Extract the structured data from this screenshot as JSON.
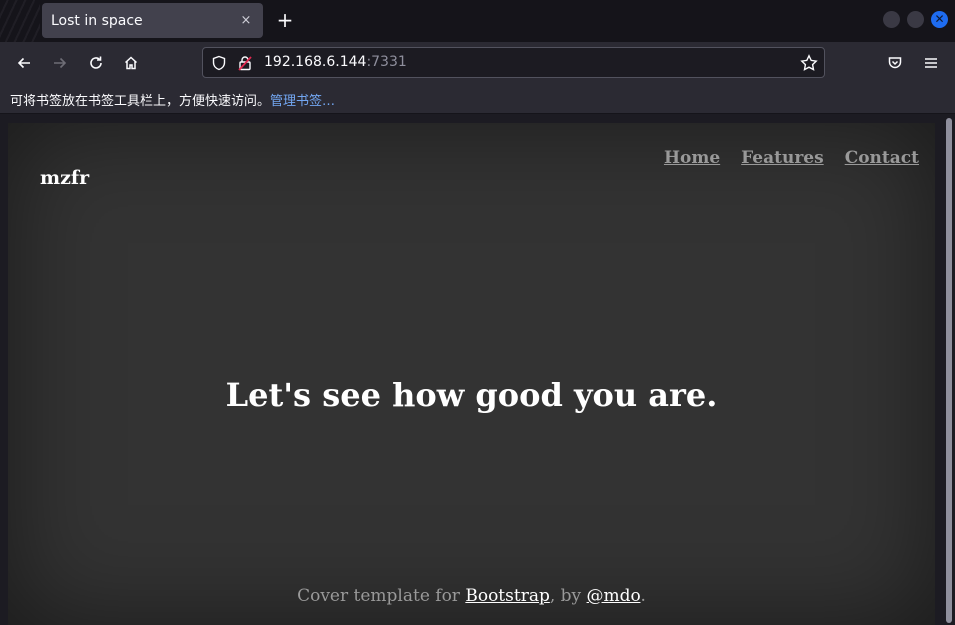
{
  "browser": {
    "tab": {
      "title": "Lost in space",
      "close_glyph": "×"
    },
    "new_tab_glyph": "+",
    "url": {
      "host": "192.168.6.144",
      "port": ":7331"
    },
    "bookmarks": {
      "message": "可将书签放在书签工具栏上，方便快速访问。",
      "manage_link": "管理书签…"
    },
    "window_close_glyph": "✕",
    "accent": "#1e6cf0"
  },
  "page": {
    "brand": "mzfr",
    "nav": [
      "Home",
      "Features",
      "Contact"
    ],
    "headline": "Let's see how good you are.",
    "footer": {
      "prefix": "Cover template for ",
      "link1": "Bootstrap",
      "middle": ", by ",
      "link2": "@mdo",
      "suffix": "."
    }
  }
}
